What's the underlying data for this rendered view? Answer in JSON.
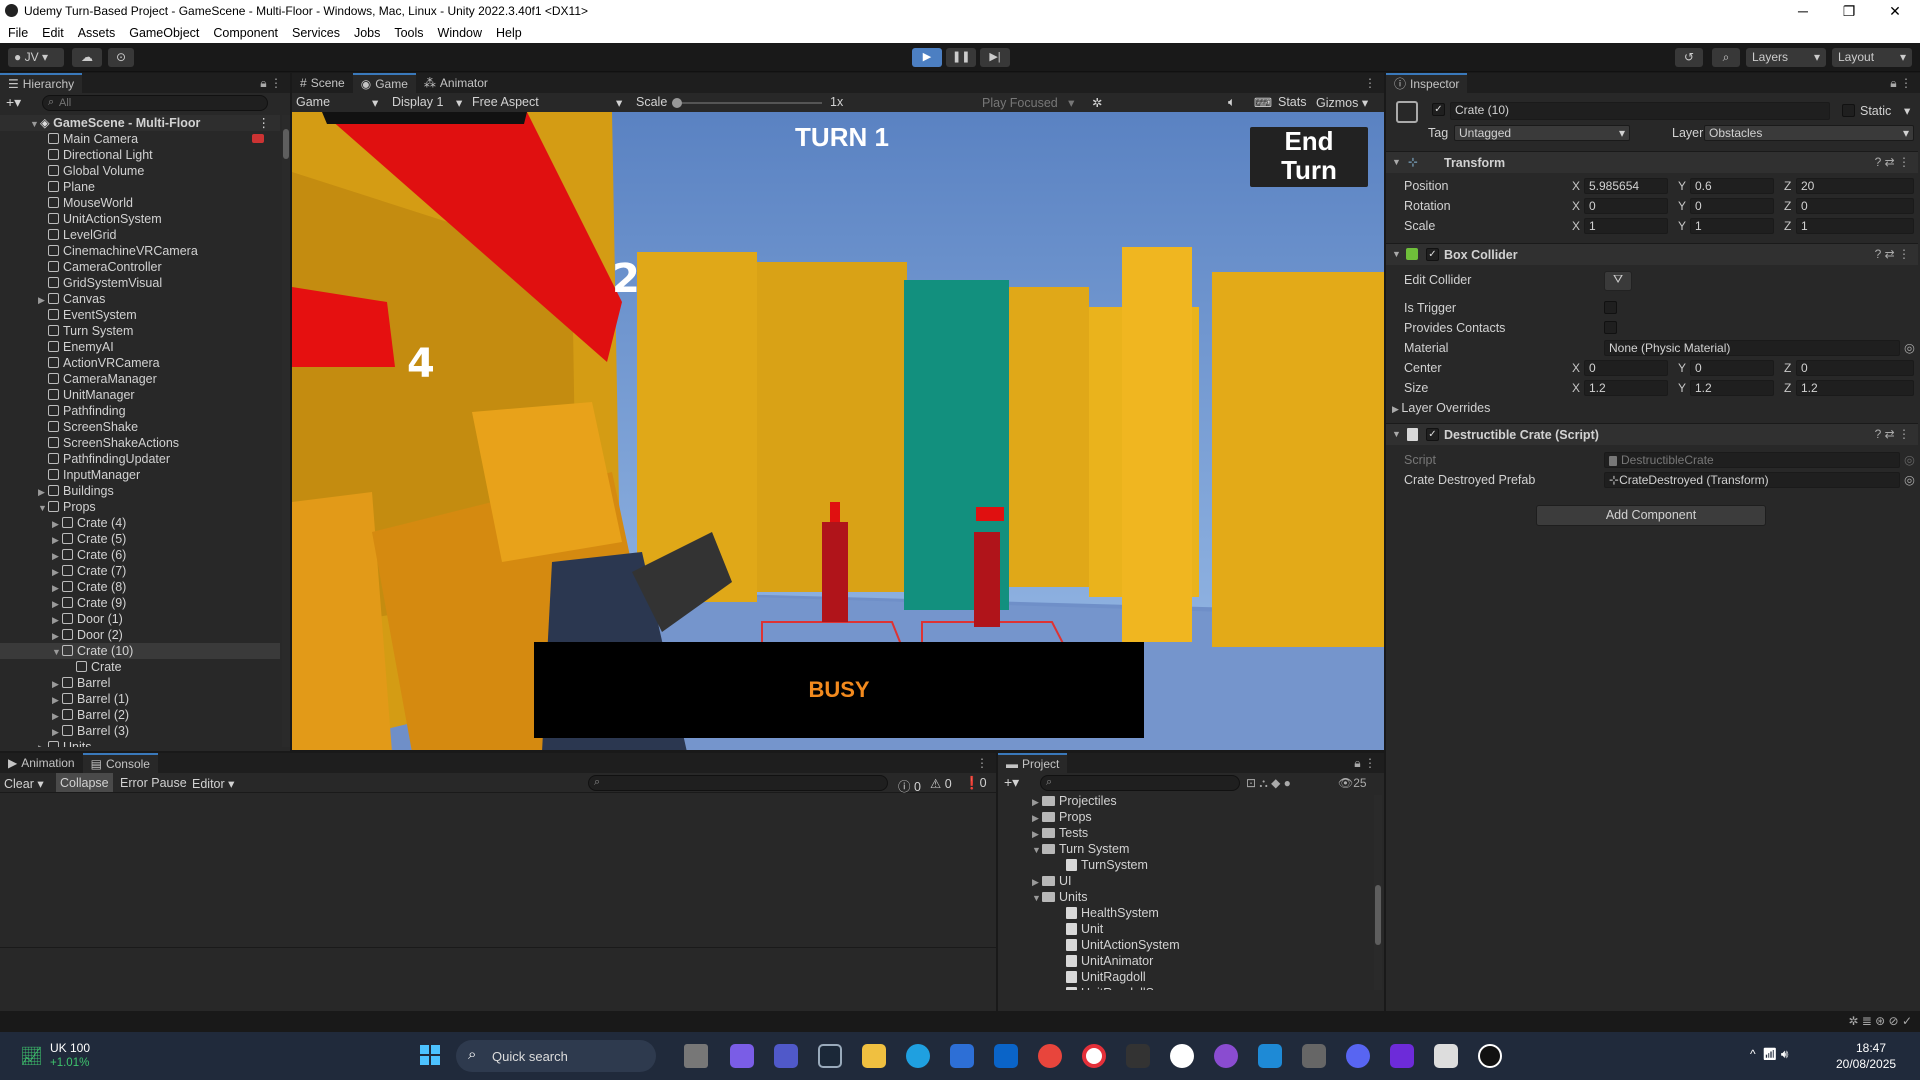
{
  "window": {
    "title": "Udemy Turn-Based Project - GameScene - Multi-Floor - Windows, Mac, Linux - Unity 2022.3.40f1 <DX11>",
    "controls": [
      "─",
      "❐",
      "✕"
    ]
  },
  "menu": [
    "File",
    "Edit",
    "Assets",
    "GameObject",
    "Component",
    "Services",
    "Jobs",
    "Tools",
    "Window",
    "Help"
  ],
  "toolbar": {
    "account": "JV",
    "layers": "Layers",
    "layout": "Layout"
  },
  "hierarchy": {
    "tab": "Hierarchy",
    "search_placeholder": "All",
    "scene": "GameScene - Multi-Floor",
    "items": [
      {
        "label": "Main Camera",
        "indent": 1,
        "arrow": ""
      },
      {
        "label": "Directional Light",
        "indent": 1,
        "arrow": ""
      },
      {
        "label": "Global Volume",
        "indent": 1,
        "arrow": ""
      },
      {
        "label": "Plane",
        "indent": 1,
        "arrow": ""
      },
      {
        "label": "MouseWorld",
        "indent": 1,
        "arrow": ""
      },
      {
        "label": "UnitActionSystem",
        "indent": 1,
        "arrow": ""
      },
      {
        "label": "LevelGrid",
        "indent": 1,
        "arrow": ""
      },
      {
        "label": "CinemachineVRCamera",
        "indent": 1,
        "arrow": ""
      },
      {
        "label": "CameraController",
        "indent": 1,
        "arrow": ""
      },
      {
        "label": "GridSystemVisual",
        "indent": 1,
        "arrow": ""
      },
      {
        "label": "Canvas",
        "indent": 1,
        "arrow": "▶"
      },
      {
        "label": "EventSystem",
        "indent": 1,
        "arrow": ""
      },
      {
        "label": "Turn System",
        "indent": 1,
        "arrow": ""
      },
      {
        "label": "EnemyAI",
        "indent": 1,
        "arrow": ""
      },
      {
        "label": "ActionVRCamera",
        "indent": 1,
        "arrow": ""
      },
      {
        "label": "CameraManager",
        "indent": 1,
        "arrow": ""
      },
      {
        "label": "UnitManager",
        "indent": 1,
        "arrow": ""
      },
      {
        "label": "Pathfinding",
        "indent": 1,
        "arrow": ""
      },
      {
        "label": "ScreenShake",
        "indent": 1,
        "arrow": ""
      },
      {
        "label": "ScreenShakeActions",
        "indent": 1,
        "arrow": ""
      },
      {
        "label": "PathfindingUpdater",
        "indent": 1,
        "arrow": ""
      },
      {
        "label": "InputManager",
        "indent": 1,
        "arrow": ""
      },
      {
        "label": "Buildings",
        "indent": 1,
        "arrow": "▶"
      },
      {
        "label": "Props",
        "indent": 1,
        "arrow": "▼"
      },
      {
        "label": "Crate (4)",
        "indent": 2,
        "arrow": "▶"
      },
      {
        "label": "Crate (5)",
        "indent": 2,
        "arrow": "▶"
      },
      {
        "label": "Crate (6)",
        "indent": 2,
        "arrow": "▶"
      },
      {
        "label": "Crate (7)",
        "indent": 2,
        "arrow": "▶"
      },
      {
        "label": "Crate (8)",
        "indent": 2,
        "arrow": "▶"
      },
      {
        "label": "Crate (9)",
        "indent": 2,
        "arrow": "▶"
      },
      {
        "label": "Door (1)",
        "indent": 2,
        "arrow": "▶"
      },
      {
        "label": "Door (2)",
        "indent": 2,
        "arrow": "▶"
      },
      {
        "label": "Crate (10)",
        "indent": 2,
        "arrow": "▼"
      },
      {
        "label": "Crate",
        "indent": 3,
        "arrow": ""
      },
      {
        "label": "Barrel",
        "indent": 2,
        "arrow": "▶"
      },
      {
        "label": "Barrel (1)",
        "indent": 2,
        "arrow": "▶"
      },
      {
        "label": "Barrel (2)",
        "indent": 2,
        "arrow": "▶"
      },
      {
        "label": "Barrel (3)",
        "indent": 2,
        "arrow": "▶"
      },
      {
        "label": "Units",
        "indent": 1,
        "arrow": "▶"
      }
    ]
  },
  "view_tabs": [
    "Scene",
    "Game",
    "Animator"
  ],
  "game_bar": {
    "mode": "Game",
    "display": "Display 1",
    "aspect": "Free Aspect",
    "scale_label": "Scale",
    "scale_value": "1x",
    "play": "Play Focused",
    "stats": "Stats",
    "gizmos": "Gizmos"
  },
  "game": {
    "turn": "TURN 1",
    "end_turn_l1": "End",
    "end_turn_l2": "Turn",
    "busy": "BUSY",
    "wall_num_a": "4",
    "wall_num_b": "2"
  },
  "inspector": {
    "tab": "Inspector",
    "object_name": "Crate (10)",
    "static_label": "Static",
    "tag_label": "Tag",
    "tag_value": "Untagged",
    "layer_label": "Layer",
    "layer_value": "Obstacles",
    "transform": {
      "title": "Transform",
      "position_label": "Position",
      "position": [
        "5.985654",
        "0.6",
        "20"
      ],
      "rotation_label": "Rotation",
      "rotation": [
        "0",
        "0",
        "0"
      ],
      "scale_label": "Scale",
      "scale": [
        "1",
        "1",
        "1"
      ]
    },
    "box_collider": {
      "title": "Box Collider",
      "edit_collider": "Edit Collider",
      "is_trigger": "Is Trigger",
      "provides_contacts": "Provides Contacts",
      "material_label": "Material",
      "material": "None (Physic Material)",
      "center_label": "Center",
      "center": [
        "0",
        "0",
        "0"
      ],
      "size_label": "Size",
      "size": [
        "1.2",
        "1.2",
        "1.2"
      ],
      "layer_overrides": "Layer Overrides"
    },
    "destructible": {
      "title": "Destructible Crate (Script)",
      "script_label": "Script",
      "script": "DestructibleCrate",
      "prefab_label": "Crate Destroyed Prefab",
      "prefab": "CrateDestroyed (Transform)"
    },
    "add_component": "Add Component"
  },
  "bottom_tabs": [
    "Animation",
    "Console"
  ],
  "console": {
    "clear": "Clear",
    "collapse": "Collapse",
    "error_pause": "Error Pause",
    "editor": "Editor",
    "counts": [
      "0",
      "0",
      "0"
    ]
  },
  "project": {
    "tab": "Project",
    "count": "25",
    "items": [
      {
        "label": "Projectiles",
        "type": "folder",
        "arrow": "▶",
        "indent": 0
      },
      {
        "label": "Props",
        "type": "folder",
        "arrow": "▶",
        "indent": 0
      },
      {
        "label": "Tests",
        "type": "folder",
        "arrow": "▶",
        "indent": 0
      },
      {
        "label": "Turn System",
        "type": "folder",
        "arrow": "▼",
        "indent": 0
      },
      {
        "label": "TurnSystem",
        "type": "script",
        "arrow": "",
        "indent": 1
      },
      {
        "label": "UI",
        "type": "folder",
        "arrow": "▶",
        "indent": 0
      },
      {
        "label": "Units",
        "type": "folder",
        "arrow": "▼",
        "indent": 0
      },
      {
        "label": "HealthSystem",
        "type": "script",
        "arrow": "",
        "indent": 1
      },
      {
        "label": "Unit",
        "type": "script",
        "arrow": "",
        "indent": 1
      },
      {
        "label": "UnitActionSystem",
        "type": "script",
        "arrow": "",
        "indent": 1
      },
      {
        "label": "UnitAnimator",
        "type": "script",
        "arrow": "",
        "indent": 1
      },
      {
        "label": "UnitRagdoll",
        "type": "script",
        "arrow": "",
        "indent": 1
      },
      {
        "label": "UnitRagdollSpawner",
        "type": "script",
        "arrow": "",
        "indent": 1
      }
    ]
  },
  "taskbar": {
    "ticker": "UK 100",
    "change": "+1.01%",
    "search": "Quick search",
    "time": "18:47",
    "date": "20/08/2025"
  },
  "colors": {
    "accent": "#3a79bb",
    "selection": "#2c5d87",
    "busy": "#f28a1e",
    "play": "#4c7fc2"
  }
}
